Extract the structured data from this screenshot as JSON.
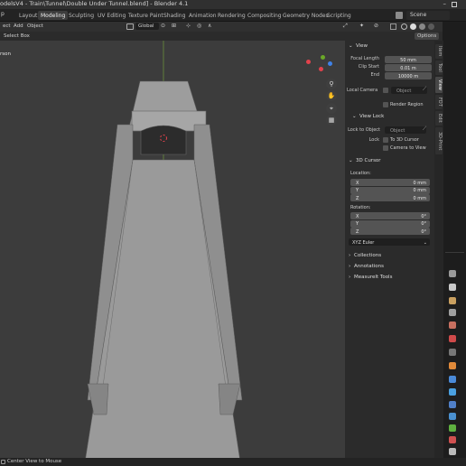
{
  "window": {
    "title": "odelsV4 - Train\\Tunnel\\Double Under Tunnel.blend] - Blender 4.1"
  },
  "topbar": {
    "logo_text": "p",
    "tabs": [
      "Layout",
      "Modeling",
      "Sculpting",
      "UV Editing",
      "Texture Paint",
      "Shading",
      "Animation",
      "Rendering",
      "Compositing",
      "Geometry Nodes",
      "Scripting"
    ],
    "active_tab": "Modeling",
    "scene": "Scene"
  },
  "header": {
    "menus": [
      "ect",
      "Add",
      "Object"
    ],
    "transform": "Global",
    "select_mode": "Select Box",
    "options": "Options"
  },
  "viewport": {
    "overlay_text": "rson"
  },
  "npanel": {
    "tabs": [
      "Item",
      "Tool",
      "View",
      "FDT",
      "Edit",
      "3D-Print"
    ],
    "active_tab": "View",
    "view": {
      "title": "View",
      "focal_length_label": "Focal Length",
      "focal_length": "50 mm",
      "clip_start_label": "Clip Start",
      "clip_start": "0.01 m",
      "end_label": "End",
      "end": "10000 m",
      "local_camera_label": "Local Camera",
      "local_camera_placeholder": "Object",
      "render_region": "Render Region"
    },
    "view_lock": {
      "title": "View Lock",
      "lock_to_object_label": "Lock to Object",
      "lock_to_object_placeholder": "Object",
      "lock_label": "Lock",
      "to_3d_cursor": "To 3D Cursor",
      "camera_to_view": "Camera to View"
    },
    "cursor": {
      "title": "3D Cursor",
      "location_label": "Location:",
      "location": [
        {
          "axis": "X",
          "value": "0 mm"
        },
        {
          "axis": "Y",
          "value": "0 mm"
        },
        {
          "axis": "Z",
          "value": "0 mm"
        }
      ],
      "rotation_label": "Rotation:",
      "rotation": [
        {
          "axis": "X",
          "value": "0°"
        },
        {
          "axis": "Y",
          "value": "0°"
        },
        {
          "axis": "Z",
          "value": "0°"
        }
      ],
      "rotation_mode": "XYZ Euler"
    },
    "collapsed": [
      "Collections",
      "Annotations",
      "MeasureIt Tools"
    ]
  },
  "statusbar": {
    "hint": "Center View to Mouse"
  },
  "colors": {
    "gizmo_x": "#e2424c",
    "gizmo_y": "#6aa828",
    "gizmo_z": "#3f82e8",
    "active_tab": "#3d3d3d"
  }
}
